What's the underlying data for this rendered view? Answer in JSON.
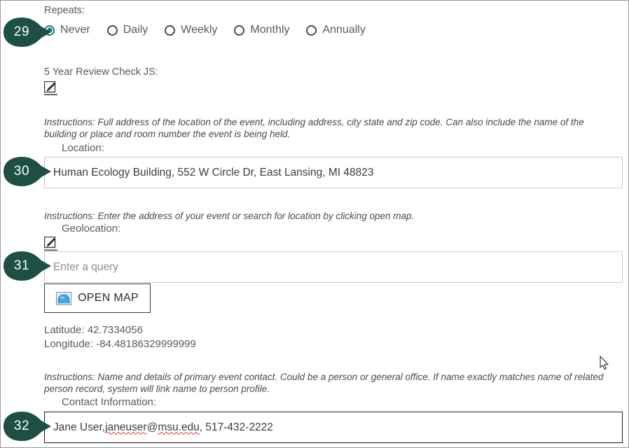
{
  "theme": {
    "badge_color": "#1d4f45",
    "accent_teal": "#0d7c7c",
    "text_gray": "#5a5a5a",
    "border_gray": "#c8c8c8",
    "border_focus": "#1a1a1a",
    "spellcheck_red": "#e03030"
  },
  "repeats": {
    "label": "Repeats:",
    "badge": "29",
    "options": [
      {
        "label": "Never",
        "selected": true
      },
      {
        "label": "Daily",
        "selected": false
      },
      {
        "label": "Weekly",
        "selected": false
      },
      {
        "label": "Monthly",
        "selected": false
      },
      {
        "label": "Annually",
        "selected": false
      }
    ]
  },
  "review_check": {
    "label": "5 Year Review Check JS:",
    "icon": "edit-pencil-icon"
  },
  "location": {
    "badge": "30",
    "instructions": "Instructions: Full address of the location of the event, including address, city state and zip code. Can also include the name of the building or place and room number the event is being held.",
    "field_label": "Location:",
    "value": "Human Ecology Building, 552 W Circle Dr, East Lansing, MI 48823",
    "placeholder": ""
  },
  "geolocation": {
    "badge": "31",
    "instructions": "Instructions: Enter the address of your event or search for location by clicking open map.",
    "field_label": "Geolocation:",
    "icon": "edit-pencil-icon",
    "placeholder": "Enter a query",
    "value": "",
    "open_map_label": "OPEN MAP",
    "open_map_icon": "map-image-icon",
    "latitude_line": "Latitude: 42.7334056",
    "longitude_line": "Longitude: -84.48186329999999",
    "latitude": "42.7334056",
    "longitude": "-84.48186329999999"
  },
  "contact": {
    "badge": "32",
    "instructions": "Instructions: Name and details of primary event contact. Could be a person or general office. If name exactly matches name of related person record, system will link name to person profile.",
    "field_label": "Contact Information:",
    "value_parts": {
      "before": "Jane User, ",
      "misspelled_user": "janeuser",
      "at": "@",
      "misspelled_domain": "msu.edu",
      "after": ", 517-432-2222"
    },
    "value": "Jane User, janeuser@msu.edu, 517-432-2222"
  }
}
